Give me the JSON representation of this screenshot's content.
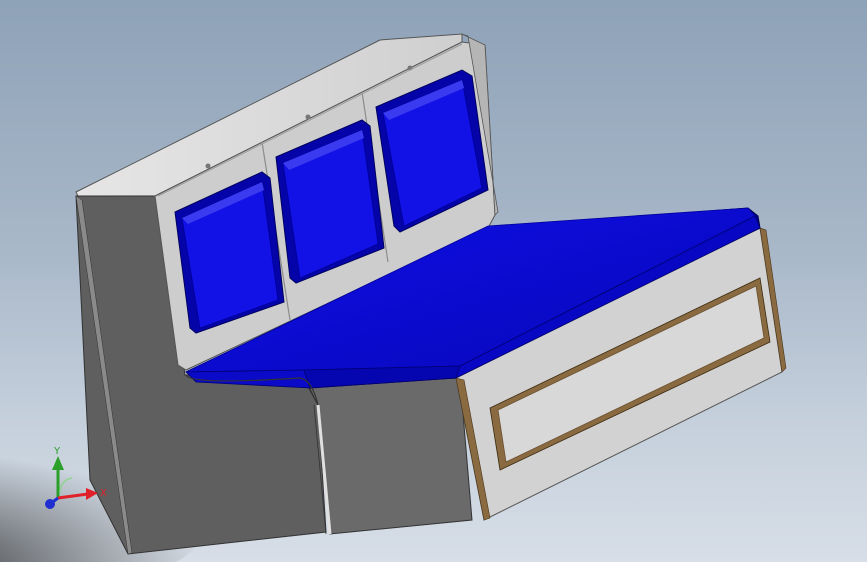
{
  "viewport": {
    "background_top": "#8ea2b8",
    "background_bottom": "#d7dee7"
  },
  "model": {
    "panel_gray": "#c9c9c9",
    "panel_light": "#dcdcdc",
    "panel_dark": "#5d5d5d",
    "panel_mid": "#8a8a8a",
    "cushion_blue": "#0a0ad6",
    "cushion_dark": "#00008a",
    "wood_trim": "#7a5a35",
    "back_cushion_count": 3
  },
  "triad": {
    "x_label": "X",
    "y_label": "Y",
    "x_color": "#e0202a",
    "y_color": "#2aa02a",
    "z_color": "#2030d0"
  }
}
